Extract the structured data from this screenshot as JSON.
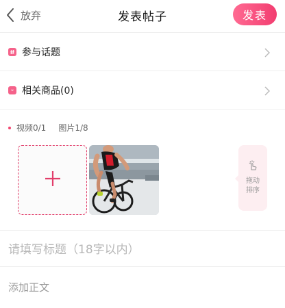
{
  "header": {
    "back_label": "放弃",
    "title": "发表帖子",
    "publish_label": "发表"
  },
  "rows": {
    "topic_label": "参与话题",
    "goods_label": "相关商品(0)"
  },
  "media": {
    "video_count": "视频0/1",
    "image_count": "图片1/8",
    "drag_tip": "拖动排序"
  },
  "inputs": {
    "title_placeholder": "请填写标题（18字以内）",
    "body_placeholder": "添加正文"
  },
  "colors": {
    "accent": "#f23d70",
    "divider": "#efefef"
  }
}
